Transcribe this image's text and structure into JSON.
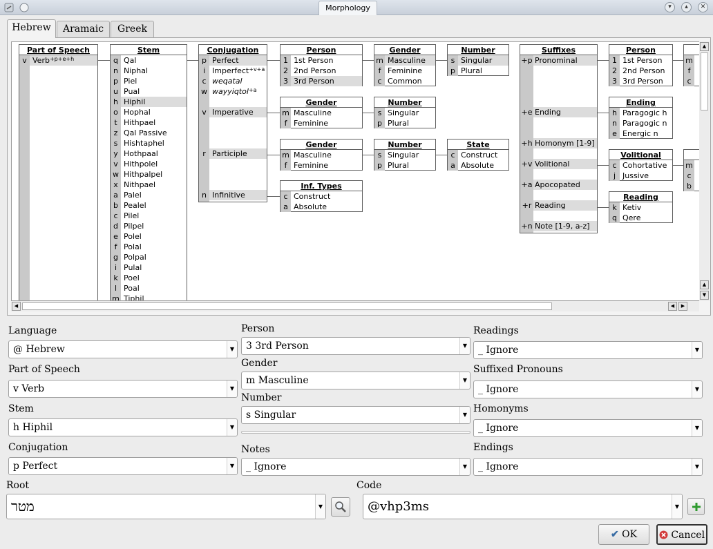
{
  "window": {
    "title": "Morphology"
  },
  "tabs": [
    "Hebrew",
    "Aramaic",
    "Greek"
  ],
  "grid": {
    "pos": {
      "title": "Part of Speech",
      "rows": [
        {
          "code": "v",
          "label": "Verb",
          "sup": "+p+e+h"
        }
      ]
    },
    "stem": {
      "title": "Stem",
      "rows": [
        {
          "code": "q",
          "label": "Qal"
        },
        {
          "code": "n",
          "label": "Niphal"
        },
        {
          "code": "p",
          "label": "Piel"
        },
        {
          "code": "u",
          "label": "Pual"
        },
        {
          "code": "h",
          "label": "Hiphil"
        },
        {
          "code": "o",
          "label": "Hophal"
        },
        {
          "code": "t",
          "label": "Hithpael"
        },
        {
          "code": "z",
          "label": "Qal Passive"
        },
        {
          "code": "s",
          "label": "Hishtaphel"
        },
        {
          "code": "y",
          "label": "Hothpaal"
        },
        {
          "code": "v",
          "label": "Hithpolel"
        },
        {
          "code": "w",
          "label": "Hithpalpel"
        },
        {
          "code": "x",
          "label": "Nithpael"
        },
        {
          "code": "a",
          "label": "Palel"
        },
        {
          "code": "b",
          "label": "Pealel"
        },
        {
          "code": "c",
          "label": "Pilel"
        },
        {
          "code": "d",
          "label": "Pilpel"
        },
        {
          "code": "e",
          "label": "Polel"
        },
        {
          "code": "f",
          "label": "Polal"
        },
        {
          "code": "g",
          "label": "Polpal"
        },
        {
          "code": "i",
          "label": "Pulal"
        },
        {
          "code": "k",
          "label": "Poel"
        },
        {
          "code": "l",
          "label": "Poal"
        },
        {
          "code": "m",
          "label": "Tiphil"
        }
      ]
    },
    "conj": {
      "title": "Conjugation",
      "rows": [
        {
          "code": "p",
          "label": "Perfect"
        },
        {
          "code": "i",
          "label": "Imperfect",
          "sup": "+v+a"
        },
        {
          "code": "c",
          "label": "weqatal"
        },
        {
          "code": "w",
          "label": "wayyiqtol",
          "sup": "+a"
        },
        {
          "code": "",
          "label": ""
        },
        {
          "code": "v",
          "label": "Imperative"
        },
        {
          "code": "",
          "label": ""
        },
        {
          "code": "",
          "label": ""
        },
        {
          "code": "",
          "label": ""
        },
        {
          "code": "r",
          "label": "Participle"
        },
        {
          "code": "",
          "label": ""
        },
        {
          "code": "",
          "label": ""
        },
        {
          "code": "",
          "label": ""
        },
        {
          "code": "n",
          "label": "Infinitive"
        }
      ]
    },
    "person1": {
      "title": "Person",
      "rows": [
        {
          "code": "1",
          "label": "1st Person"
        },
        {
          "code": "2",
          "label": "2nd Person"
        },
        {
          "code": "3",
          "label": "3rd Person"
        }
      ]
    },
    "gender1": {
      "title": "Gender",
      "rows": [
        {
          "code": "m",
          "label": "Masculine"
        },
        {
          "code": "f",
          "label": "Feminine"
        },
        {
          "code": "c",
          "label": "Common"
        }
      ]
    },
    "number1": {
      "title": "Number",
      "rows": [
        {
          "code": "s",
          "label": "Singular"
        },
        {
          "code": "p",
          "label": "Plural"
        }
      ]
    },
    "gender2": {
      "title": "Gender",
      "rows": [
        {
          "code": "m",
          "label": "Masculine"
        },
        {
          "code": "f",
          "label": "Feminine"
        }
      ]
    },
    "number2": {
      "title": "Number",
      "rows": [
        {
          "code": "s",
          "label": "Singular"
        },
        {
          "code": "p",
          "label": "Plural"
        }
      ]
    },
    "gender3": {
      "title": "Gender",
      "rows": [
        {
          "code": "m",
          "label": "Masculine"
        },
        {
          "code": "f",
          "label": "Feminine"
        }
      ]
    },
    "number3": {
      "title": "Number",
      "rows": [
        {
          "code": "s",
          "label": "Singular"
        },
        {
          "code": "p",
          "label": "Plural"
        }
      ]
    },
    "state": {
      "title": "State",
      "rows": [
        {
          "code": "c",
          "label": "Construct"
        },
        {
          "code": "a",
          "label": "Absolute"
        }
      ]
    },
    "inf": {
      "title": "Inf. Types",
      "rows": [
        {
          "code": "c",
          "label": "Construct"
        },
        {
          "code": "a",
          "label": "Absolute"
        }
      ]
    },
    "suffixes": {
      "title": "Suffixes",
      "rows": [
        {
          "code": "+p",
          "label": "Pronominal"
        },
        {
          "code": "",
          "label": ""
        },
        {
          "code": "",
          "label": ""
        },
        {
          "code": "",
          "label": ""
        },
        {
          "code": "",
          "label": ""
        },
        {
          "code": "+e",
          "label": "Ending"
        },
        {
          "code": "",
          "label": ""
        },
        {
          "code": "",
          "label": ""
        },
        {
          "code": "+h",
          "label": "Homonym [1-9]"
        },
        {
          "code": "",
          "label": ""
        },
        {
          "code": "+v",
          "label": "Volitional"
        },
        {
          "code": "",
          "label": ""
        },
        {
          "code": "+a",
          "label": "Apocopated"
        },
        {
          "code": "",
          "label": ""
        },
        {
          "code": "+r",
          "label": "Reading"
        },
        {
          "code": "",
          "label": ""
        },
        {
          "code": "+n",
          "label": "Note [1-9, a-z]"
        }
      ]
    },
    "person2": {
      "title": "Person",
      "rows": [
        {
          "code": "1",
          "label": "1st Person"
        },
        {
          "code": "2",
          "label": "2nd Person"
        },
        {
          "code": "3",
          "label": "3rd Person"
        }
      ]
    },
    "ending": {
      "title": "Ending",
      "rows": [
        {
          "code": "h",
          "label": "Paragogic h"
        },
        {
          "code": "n",
          "label": "Paragogic n"
        },
        {
          "code": "e",
          "label": "Energic n"
        }
      ]
    },
    "volitional": {
      "title": "Volitional",
      "rows": [
        {
          "code": "c",
          "label": "Cohortative"
        },
        {
          "code": "j",
          "label": "Jussive"
        }
      ]
    },
    "reading": {
      "title": "Reading",
      "rows": [
        {
          "code": "k",
          "label": "Ketiv"
        },
        {
          "code": "q",
          "label": "Qere"
        }
      ]
    },
    "cut1": {
      "title": "",
      "rows": [
        {
          "code": "m",
          "label": ""
        },
        {
          "code": "f",
          "label": ""
        },
        {
          "code": "c",
          "label": ""
        }
      ]
    },
    "cut2": {
      "title": "",
      "rows": [
        {
          "code": "m",
          "label": ""
        },
        {
          "code": "c",
          "label": ""
        },
        {
          "code": "b",
          "label": ""
        }
      ]
    }
  },
  "form": {
    "language": {
      "label": "Language",
      "value": "@ Hebrew"
    },
    "pos": {
      "label": "Part of Speech",
      "value": "v Verb"
    },
    "stem": {
      "label": "Stem",
      "value": "h Hiphil"
    },
    "conjugation": {
      "label": "Conjugation",
      "value": "p Perfect"
    },
    "person": {
      "label": "Person",
      "value": "3 3rd Person"
    },
    "gender": {
      "label": "Gender",
      "value": "m Masculine"
    },
    "number": {
      "label": "Number",
      "value": "s Singular"
    },
    "notes": {
      "label": "Notes",
      "value": "_ Ignore"
    },
    "readings": {
      "label": "Readings",
      "value": "_ Ignore"
    },
    "suffixed": {
      "label": "Suffixed Pronouns",
      "value": "_ Ignore"
    },
    "homonyms": {
      "label": "Homonyms",
      "value": "_ Ignore"
    },
    "endings": {
      "label": "Endings",
      "value": "_ Ignore"
    },
    "root": {
      "label": "Root",
      "value": "מטר"
    },
    "code": {
      "label": "Code",
      "value": "@vhp3ms"
    }
  },
  "buttons": {
    "ok": "OK",
    "cancel": "Cancel"
  }
}
